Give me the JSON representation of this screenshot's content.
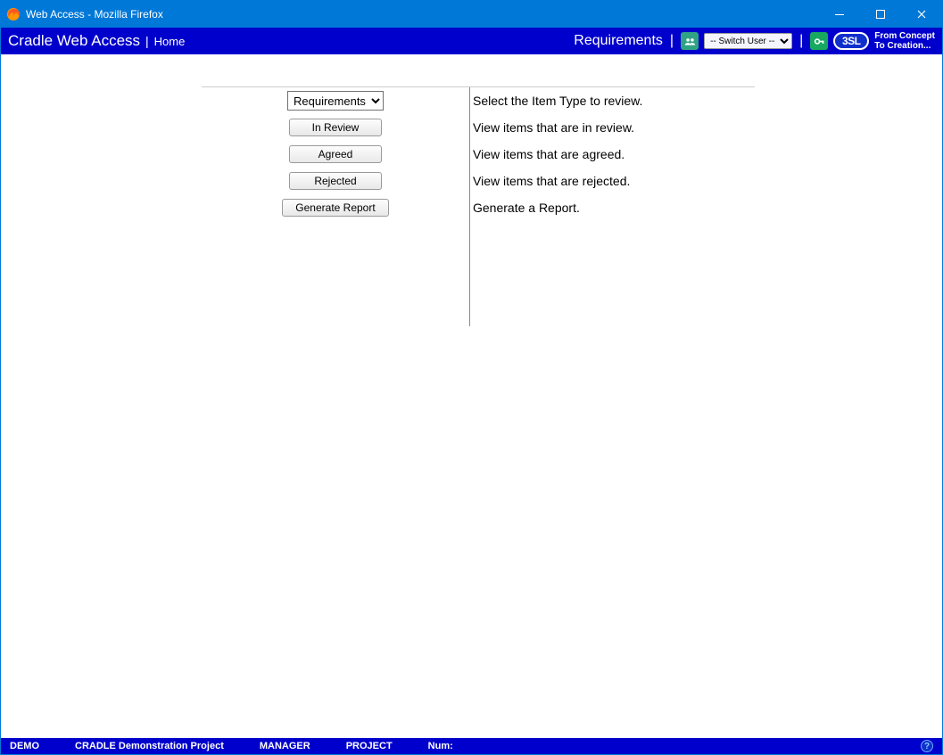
{
  "window": {
    "title": "Web Access - Mozilla Firefox"
  },
  "appbar": {
    "title": "Cradle Web Access",
    "home_label": "Home",
    "requirements_label": "Requirements",
    "switch_user_placeholder": "-- Switch User --",
    "logo_text": "3SL",
    "tagline1": "From Concept",
    "tagline2": "To Creation..."
  },
  "main": {
    "rows": [
      {
        "type": "select",
        "selected": "Requirements",
        "desc": "Select the Item Type to review."
      },
      {
        "type": "button",
        "label": "In Review",
        "desc": "View items that are in review."
      },
      {
        "type": "button",
        "label": "Agreed",
        "desc": "View items that are agreed."
      },
      {
        "type": "button",
        "label": "Rejected",
        "desc": "View items that are rejected."
      },
      {
        "type": "button_wide",
        "label": "Generate Report",
        "desc": "Generate a Report."
      }
    ]
  },
  "statusbar": {
    "items": [
      "DEMO",
      "CRADLE Demonstration Project",
      "MANAGER",
      "PROJECT",
      "Num:"
    ]
  }
}
